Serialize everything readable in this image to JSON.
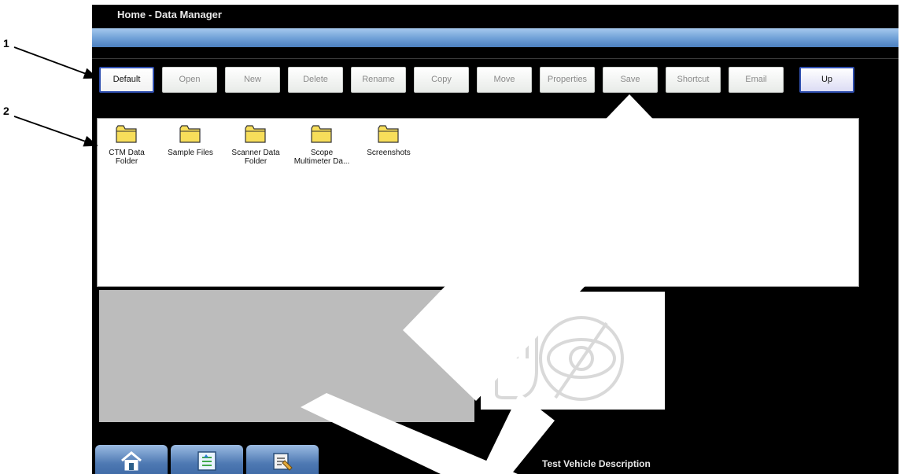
{
  "header": {
    "title": "Home - Data Manager"
  },
  "toolbar": {
    "buttons": [
      "Default",
      "Open",
      "New",
      "Delete",
      "Rename",
      "Copy",
      "Move",
      "Properties",
      "Save",
      "Shortcut",
      "Email",
      "Up"
    ]
  },
  "files": [
    {
      "label1": "CTM Data",
      "label2": "Folder"
    },
    {
      "label1": "Sample Files",
      "label2": ""
    },
    {
      "label1": "Scanner Data",
      "label2": "Folder"
    },
    {
      "label1": "Scope",
      "label2": "Multimeter Da..."
    },
    {
      "label1": "Screenshots",
      "label2": ""
    }
  ],
  "status": {
    "vehicle": "Test Vehicle Description"
  },
  "callouts": [
    "1",
    "2"
  ],
  "icons": {
    "folder": "folder-icon",
    "nav": [
      "home-icon",
      "data-manager-icon",
      "tools-icon"
    ],
    "preview": "no-preview-icon"
  },
  "colors": {
    "screen_bg": "#000000",
    "header_bar": "#6e9fd6",
    "folder_fill": "#f7de5a",
    "active_border": "#2f4fb0"
  }
}
